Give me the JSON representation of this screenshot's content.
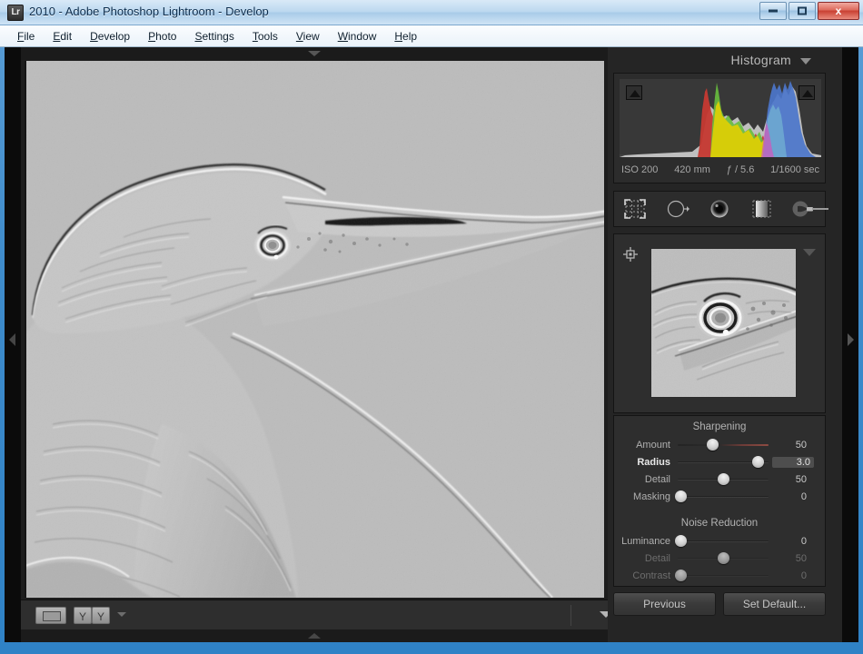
{
  "window": {
    "title": "2010 - Adobe Photoshop Lightroom - Develop",
    "app_icon": "Lr",
    "minimize_label": "",
    "maximize_label": "",
    "close_label": "x"
  },
  "menubar": {
    "items": [
      {
        "label": "File",
        "mnemonic": "F",
        "rest": "ile"
      },
      {
        "label": "Edit",
        "mnemonic": "E",
        "rest": "dit"
      },
      {
        "label": "Develop",
        "mnemonic": "D",
        "rest": "evelop"
      },
      {
        "label": "Photo",
        "mnemonic": "P",
        "rest": "hoto"
      },
      {
        "label": "Settings",
        "mnemonic": "S",
        "rest": "ettings"
      },
      {
        "label": "Tools",
        "mnemonic": "T",
        "rest": "ools"
      },
      {
        "label": "View",
        "mnemonic": "V",
        "rest": "iew"
      },
      {
        "label": "Window",
        "mnemonic": "W",
        "rest": "indow"
      },
      {
        "label": "Help",
        "mnemonic": "H",
        "rest": "elp"
      }
    ]
  },
  "right_panel": {
    "histogram": {
      "title": "Histogram",
      "iso": "ISO 200",
      "focal_length": "420 mm",
      "aperture": "ƒ / 5.6",
      "shutter": "1/1600 sec"
    },
    "tools": [
      {
        "name": "crop-overlay-tool"
      },
      {
        "name": "spot-removal-tool"
      },
      {
        "name": "red-eye-tool"
      },
      {
        "name": "graduated-filter-tool"
      },
      {
        "name": "adjustment-brush-tool"
      }
    ],
    "detail": {
      "target_icon": "loupe-target-icon"
    },
    "sharpening": {
      "title": "Sharpening",
      "sliders": [
        {
          "label": "Amount",
          "value": "50",
          "pos": 38,
          "active": false,
          "disabled": false,
          "tinted": true
        },
        {
          "label": "Radius",
          "value": "3.0",
          "pos": 88,
          "active": true,
          "disabled": false,
          "tinted": false
        },
        {
          "label": "Detail",
          "value": "50",
          "pos": 50,
          "active": false,
          "disabled": false,
          "tinted": false
        },
        {
          "label": "Masking",
          "value": "0",
          "pos": 3,
          "active": false,
          "disabled": false,
          "tinted": false
        }
      ]
    },
    "noise_reduction": {
      "title": "Noise Reduction",
      "sliders": [
        {
          "label": "Luminance",
          "value": "0",
          "pos": 3,
          "active": false,
          "disabled": false,
          "tinted": false
        },
        {
          "label": "Detail",
          "value": "50",
          "pos": 50,
          "active": false,
          "disabled": true,
          "tinted": false
        },
        {
          "label": "Contrast",
          "value": "0",
          "pos": 3,
          "active": false,
          "disabled": true,
          "tinted": false
        }
      ]
    },
    "buttons": {
      "previous": "Previous",
      "set_default": "Set Default..."
    }
  },
  "toolbar": {
    "loupe_view": "loupe-view-button",
    "before_after": "before-after-button",
    "before_after_alt": "before-after-alt-button",
    "y_glyph": "Y",
    "dropdown": "toolbar-dropdown"
  },
  "colors": {
    "panel_bg": "#252525",
    "panel_section": "#2e2e2e",
    "accent_red": "#8d4b42",
    "window_border": "#3f8ccb",
    "text": "#b0b0b0"
  }
}
